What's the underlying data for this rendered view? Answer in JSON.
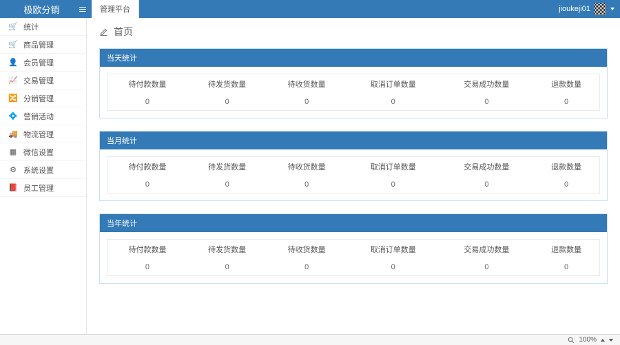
{
  "brand": "极欧分销",
  "tab_label": "管理平台",
  "user_name": "jioukeji01",
  "sidebar": {
    "items": [
      {
        "icon": "🛒",
        "label": "统计"
      },
      {
        "icon": "🛒",
        "label": "商品管理"
      },
      {
        "icon": "👤",
        "label": "会员管理"
      },
      {
        "icon": "📈",
        "label": "交易管理"
      },
      {
        "icon": "🔀",
        "label": "分销管理"
      },
      {
        "icon": "💠",
        "label": "营销活动"
      },
      {
        "icon": "🚚",
        "label": "物流管理"
      },
      {
        "icon": "▦",
        "label": "微信设置"
      },
      {
        "icon": "⚙",
        "label": "系统设置"
      },
      {
        "icon": "📕",
        "label": "员工管理"
      }
    ]
  },
  "page_title": "首页",
  "stat_headers": [
    "待付款数量",
    "待发货数量",
    "待收货数量",
    "取消订单数量",
    "交易成功数量",
    "退款数量"
  ],
  "panels": [
    {
      "title": "当天统计",
      "values": [
        "0",
        "0",
        "0",
        "0",
        "0",
        "0"
      ]
    },
    {
      "title": "当月统计",
      "values": [
        "0",
        "0",
        "0",
        "0",
        "0",
        "0"
      ]
    },
    {
      "title": "当年统计",
      "values": [
        "0",
        "0",
        "0",
        "0",
        "0",
        "0"
      ]
    }
  ],
  "zoom_label": "100%"
}
